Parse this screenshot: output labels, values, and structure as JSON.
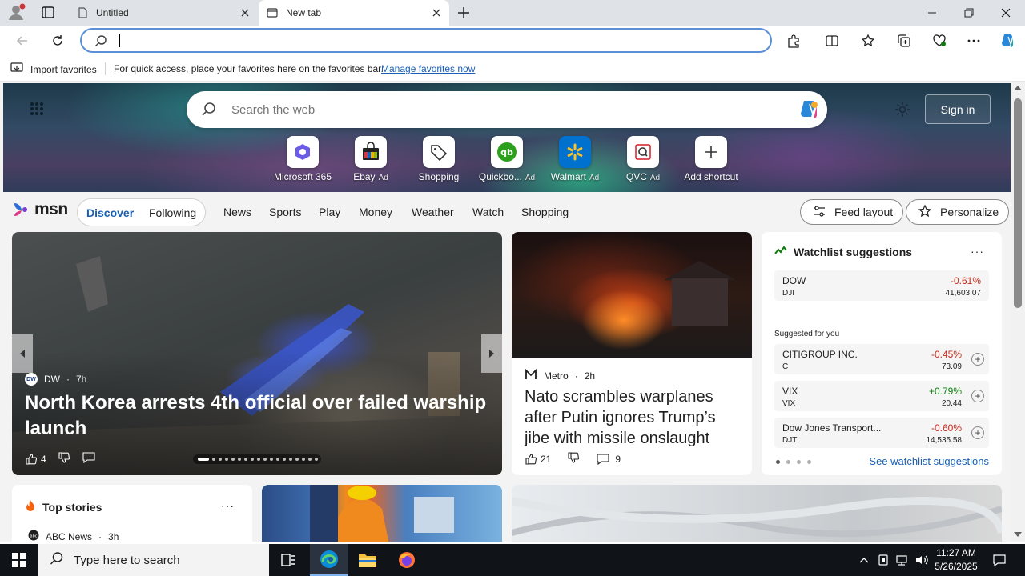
{
  "tabs": [
    {
      "title": "Untitled"
    },
    {
      "title": "New tab"
    }
  ],
  "address_bar": {
    "value": "",
    "placeholder": ""
  },
  "favorites_bar": {
    "import_label": "Import favorites",
    "message": "For quick access, place your favorites here on the favorites bar.",
    "manage_link": "Manage favorites now"
  },
  "hero": {
    "search_placeholder": "Search the web",
    "sign_in": "Sign in",
    "shortcuts": [
      {
        "label": "Microsoft 365",
        "ad": ""
      },
      {
        "label": "Ebay",
        "ad": "Ad"
      },
      {
        "label": "Shopping",
        "ad": ""
      },
      {
        "label": "Quickbo...",
        "ad": "Ad"
      },
      {
        "label": "Walmart",
        "ad": "Ad"
      },
      {
        "label": "QVC",
        "ad": "Ad"
      },
      {
        "label": "Add shortcut",
        "ad": ""
      }
    ]
  },
  "msn": {
    "logo": "msn",
    "pill": [
      "Discover",
      "Following"
    ],
    "nav": [
      "News",
      "Sports",
      "Play",
      "Money",
      "Weather",
      "Watch",
      "Shopping"
    ],
    "feed_layout": "Feed layout",
    "personalize": "Personalize"
  },
  "hero_story": {
    "source": "DW",
    "source_logo": "DW",
    "age": "7h",
    "title": "North Korea arrests 4th official over failed warship launch",
    "likes": "4"
  },
  "news_story": {
    "source": "Metro",
    "age": "2h",
    "title": "Nato scrambles warplanes after Putin ignores Trump’s jibe with missile onslaught",
    "likes": "21",
    "comments": "9"
  },
  "watchlist": {
    "title": "Watchlist suggestions",
    "more": "···",
    "main": {
      "name": "DOW",
      "symbol": "DJI",
      "change": "-0.61%",
      "price": "41,603.07"
    },
    "suggested_label": "Suggested for you",
    "items": [
      {
        "name": "CITIGROUP INC.",
        "symbol": "C",
        "change": "-0.45%",
        "price": "73.09"
      },
      {
        "name": "VIX",
        "symbol": "VIX",
        "change": "+0.79%",
        "price": "20.44"
      },
      {
        "name": "Dow Jones Transport...",
        "symbol": "DJT",
        "change": "-0.60%",
        "price": "14,535.58"
      }
    ],
    "link": "See watchlist suggestions"
  },
  "top_stories": {
    "title": "Top stories",
    "more": "···",
    "source": "ABC News",
    "age": "3h"
  },
  "taskbar": {
    "search_placeholder": "Type here to search",
    "time": "11:27 AM",
    "date": "5/26/2025"
  },
  "colors": {
    "accent": "#1a5fb4",
    "negative": "#c42b1c",
    "positive": "#107c10",
    "taskbar": "#101318"
  }
}
